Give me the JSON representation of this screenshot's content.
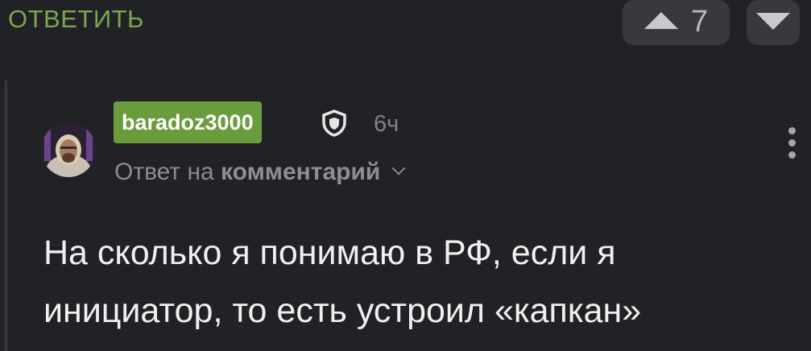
{
  "reply_link": "ОТВЕТИТЬ",
  "votes": {
    "up_icon": "triangle-up-icon",
    "count": "7",
    "down_icon": "triangle-down-icon"
  },
  "comment": {
    "username": "baradoz3000",
    "badge_icon": "shield-icon",
    "time": "6ч",
    "reply_prefix": "Ответ на",
    "reply_target": "комментарий",
    "more_icon": "vertical-dots-icon",
    "text_line1": "На сколько я понимаю в РФ, если я",
    "text_line2": "инициатор, то есть устроил «капкан»"
  },
  "colors": {
    "background": "#212225",
    "accent_green": "#7ea551",
    "username_badge": "#6a9b3c",
    "vote_button_bg": "#38393d"
  }
}
